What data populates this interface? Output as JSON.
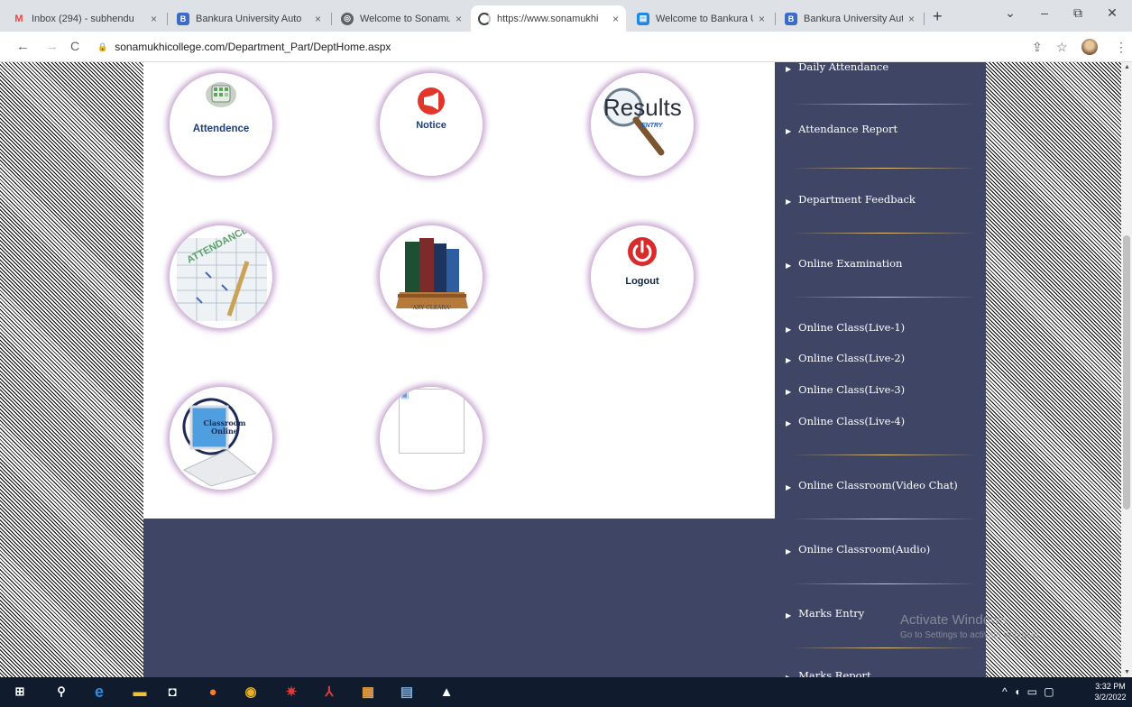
{
  "browser": {
    "tabs": [
      {
        "title": "Inbox (294) - subhendu",
        "icon": "gmail-icon",
        "fav_color": "#ea4335",
        "fav_glyph": "M"
      },
      {
        "title": "Bankura University Auto",
        "icon": "bankura-university-icon",
        "fav_color": "#3b6bc4",
        "fav_glyph": "B"
      },
      {
        "title": "Welcome to Sonamukhi",
        "icon": "globe-icon",
        "fav_color": "#5f6368",
        "fav_glyph": "◎"
      },
      {
        "title": "https://www.sonamukhi",
        "icon": "loading-icon",
        "fav_color": "#3c4043",
        "fav_glyph": "◔"
      },
      {
        "title": "Welcome to Bankura Un",
        "icon": "site-icon",
        "fav_color": "#1e88e5",
        "fav_glyph": "▤"
      },
      {
        "title": "Bankura University Auto",
        "icon": "bankura-university-icon",
        "fav_color": "#3b6bc4",
        "fav_glyph": "B"
      }
    ],
    "close_glyph": "×",
    "new_tab_glyph": "+",
    "url": "sonamukhicollege.com/Department_Part/DeptHome.aspx",
    "lock_glyph": "🔒"
  },
  "page": {
    "tiles": [
      {
        "label": "Attendence"
      },
      {
        "label": "Notice"
      },
      {
        "label": "Results",
        "sub": "ENTRY"
      },
      {
        "label": ""
      },
      {
        "label": "Library Clearance",
        "sub": "'ARY CLEARA'"
      },
      {
        "label": "Logout"
      },
      {
        "label": "Classroom Online"
      },
      {
        "label": ""
      }
    ],
    "sidebar": [
      "Daily Attendance",
      "Attendance Report",
      "Department Feedback",
      "Online Examination",
      "Online Class(Live-1)",
      "Online Class(Live-2)",
      "Online Class(Live-3)",
      "Online Class(Live-4)",
      "Online Classroom(Video Chat)",
      "Online Classroom(Audio)",
      "Marks Entry",
      "Marks Report"
    ]
  },
  "watermark": {
    "line1": "Activate Windows",
    "line2": "Go to Settings to activate Windows."
  },
  "taskbar": {
    "time": "3:32 PM",
    "date": "3/2/2022"
  },
  "colors": {
    "sidebar_bg": "#3e4565",
    "divider": "#e7c479",
    "taskbar": "#101b2d"
  }
}
